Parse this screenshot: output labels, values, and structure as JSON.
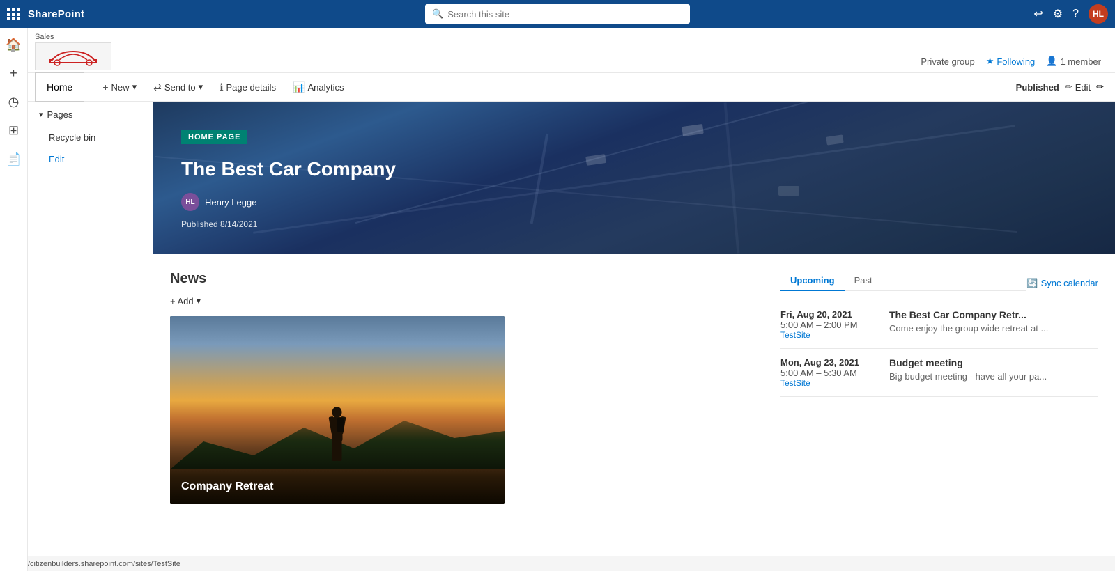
{
  "topbar": {
    "brand": "SharePoint",
    "search_placeholder": "Search this site",
    "avatar_initials": "HL"
  },
  "site": {
    "label": "Sales",
    "private_group": "Private group",
    "following": "Following",
    "members": "1 member"
  },
  "nav": {
    "home_label": "Home",
    "new_label": "New",
    "send_to_label": "Send to",
    "page_details_label": "Page details",
    "analytics_label": "Analytics",
    "published_label": "Published",
    "edit_label": "Edit"
  },
  "left_nav": {
    "home": "Home",
    "pages_section": "Pages",
    "recycle_bin": "Recycle bin",
    "edit_link": "Edit"
  },
  "hero": {
    "tag": "HOME PAGE",
    "title": "The Best Car Company",
    "author_initials": "HL",
    "author_name": "Henry Legge",
    "published": "Published 8/14/2021"
  },
  "news": {
    "title": "News",
    "add_label": "+ Add",
    "card_title": "Company Retreat"
  },
  "events": {
    "tabs": [
      "Upcoming",
      "Past"
    ],
    "sync_label": "Sync calendar",
    "items": [
      {
        "date": "Fri, Aug 20, 2021",
        "time": "5:00 AM – 2:00 PM",
        "site": "TestSite",
        "event_title": "The Best Car Company Retr...",
        "description": "Come enjoy the group wide retreat at ..."
      },
      {
        "date": "Mon, Aug 23, 2021",
        "time": "5:00 AM – 5:30 AM",
        "site": "TestSite",
        "event_title": "Budget meeting",
        "description": "Big budget meeting - have all your pa..."
      }
    ]
  },
  "statusbar": {
    "url": "https://citizenbuilders.sharepoint.com/sites/TestSite"
  }
}
